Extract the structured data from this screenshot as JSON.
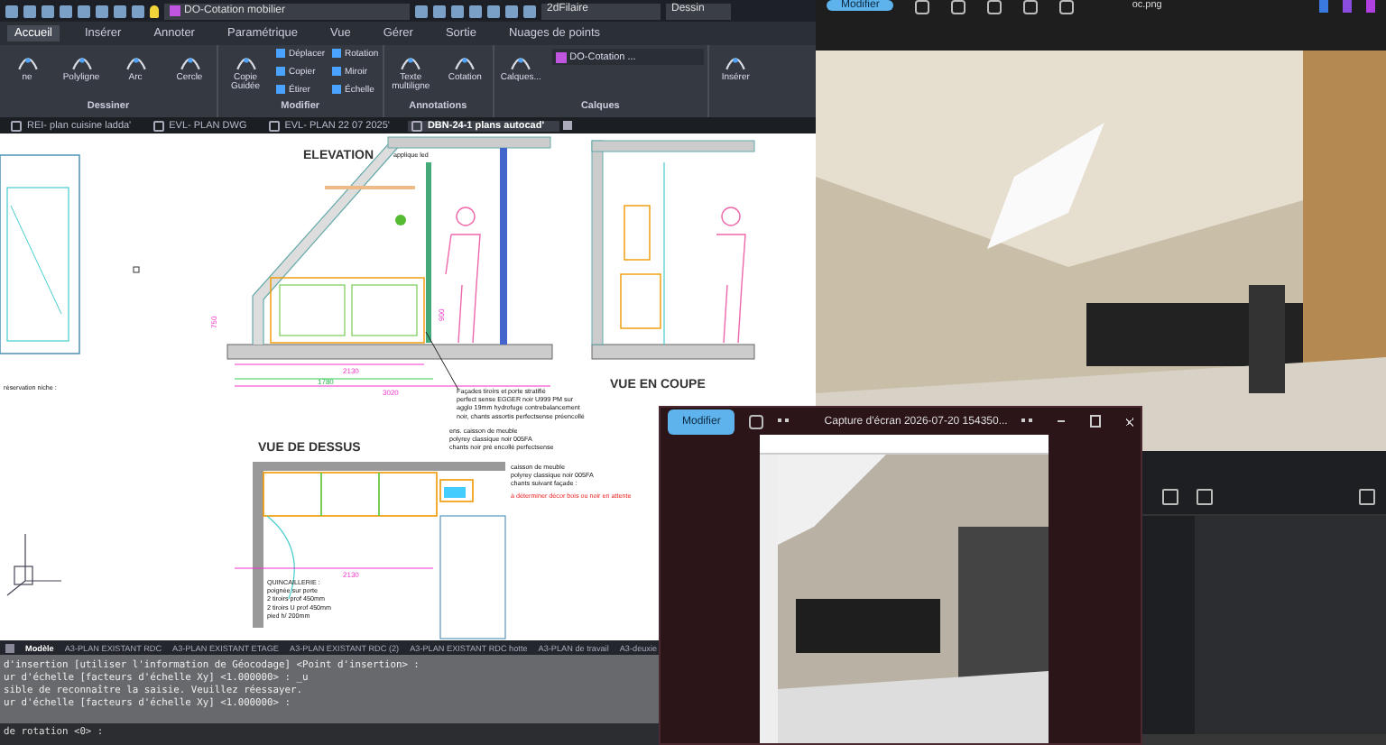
{
  "cad": {
    "quick_access": {
      "layer": "DO-Cotation mobilier",
      "visual_style": "2dFilaire",
      "workspace": "Dessin"
    },
    "ribbon_tabs": [
      {
        "label": "Accueil",
        "selected": true
      },
      {
        "label": "Insérer",
        "selected": false
      },
      {
        "label": "Annoter",
        "selected": false
      },
      {
        "label": "Paramétrique",
        "selected": false
      },
      {
        "label": "Vue",
        "selected": false
      },
      {
        "label": "Gérer",
        "selected": false
      },
      {
        "label": "Sortie",
        "selected": false
      },
      {
        "label": "Nuages de points",
        "selected": false
      }
    ],
    "panels": [
      {
        "title": "Dessiner",
        "tools": [
          {
            "label": "ne",
            "kind": "large"
          },
          {
            "label": "Polyligne",
            "kind": "large"
          },
          {
            "label": "Arc",
            "kind": "large"
          },
          {
            "label": "Cercle",
            "kind": "large"
          }
        ]
      },
      {
        "title": "Modifier",
        "tools": [
          {
            "label": "Copie Guidée",
            "kind": "large"
          },
          {
            "label": "Déplacer",
            "kind": "small"
          },
          {
            "label": "Copier",
            "kind": "small"
          },
          {
            "label": "Étirer",
            "kind": "small"
          },
          {
            "label": "Rotation",
            "kind": "small"
          },
          {
            "label": "Miroir",
            "kind": "small"
          },
          {
            "label": "Échelle",
            "kind": "small"
          }
        ]
      },
      {
        "title": "Annotations",
        "tools": [
          {
            "label": "Texte multiligne",
            "kind": "large"
          },
          {
            "label": "Cotation",
            "kind": "large"
          }
        ]
      },
      {
        "title": "Calques",
        "tools": [
          {
            "label": "Calques...",
            "kind": "large"
          },
          {
            "label": "DO-Cotation ...",
            "kind": "dropdown"
          }
        ]
      },
      {
        "tools": [
          {
            "label": "Insérer",
            "kind": "large"
          }
        ]
      }
    ],
    "doc_tabs": [
      {
        "label": "REI- plan cuisine ladda'",
        "selected": false
      },
      {
        "label": "EVL- PLAN DWG",
        "selected": false
      },
      {
        "label": "EVL- PLAN 22 07 2025'",
        "selected": false
      },
      {
        "label": "DBN-24-1 plans autocad'",
        "selected": true
      }
    ],
    "drawing": {
      "labels": [
        {
          "kind": "title",
          "lines": [
            "ELEVATION"
          ]
        },
        {
          "kind": "title",
          "lines": [
            "VUE EN COUPE"
          ]
        },
        {
          "kind": "title",
          "lines": [
            "VUE DE DESSUS"
          ]
        },
        {
          "kind": "note",
          "lines": [
            "réservation niche :"
          ]
        },
        {
          "kind": "dimension",
          "lines": [
            "2130"
          ]
        },
        {
          "kind": "dimension_alt",
          "lines": [
            "1780"
          ]
        },
        {
          "kind": "dimension",
          "lines": [
            "3020"
          ]
        },
        {
          "kind": "dimension",
          "lines": [
            "2130"
          ]
        },
        {
          "kind": "dimension",
          "lines": [
            "900"
          ]
        },
        {
          "kind": "dimension",
          "lines": [
            "750"
          ]
        },
        {
          "kind": "note",
          "lines": [
            "Façades tiroirs et porte stratifié",
            "perfect sense EGGER noir U999 PM sur",
            "agglo 19mm hydrofuge contrebalancement",
            "noir, chants assortis perfectsense préencollé"
          ]
        },
        {
          "kind": "note",
          "lines": [
            "ens. caisson de meuble",
            "polyrey classique noir 005FA",
            "chants noir pré encollé perfectsense"
          ]
        },
        {
          "kind": "note",
          "lines": [
            "caisson de meuble",
            "polyrey classique noir 005FA",
            "chants suivant façade :"
          ]
        },
        {
          "kind": "warning",
          "lines": [
            "à déterminer décor bois ou noir en attente"
          ]
        },
        {
          "kind": "note",
          "lines": [
            "QUINCAILLERIE :",
            "poignée sur porte",
            "2 tiroirs prof 450mm",
            "2 tiroirs U prof 450mm",
            "pied h/ 200mm"
          ]
        },
        {
          "kind": "note",
          "lines": [
            "applique led"
          ]
        }
      ]
    },
    "layout_tabs": [
      {
        "label": "Modèle",
        "selected": true
      },
      {
        "label": "A3-PLAN EXISTANT RDC",
        "selected": false
      },
      {
        "label": "A3-PLAN EXISTANT ETAGE",
        "selected": false
      },
      {
        "label": "A3-PLAN EXISTANT RDC (2)",
        "selected": false
      },
      {
        "label": "A3-PLAN EXISTANT RDC hotte",
        "selected": false
      },
      {
        "label": "A3-PLAN de travail",
        "selected": false
      },
      {
        "label": "A3-deuxie",
        "selected": false
      }
    ],
    "command_history": [
      "d'insertion [utiliser l'information de Géocodage] <Point d'insertion> :",
      "ur d'échelle [facteurs d'échelle Xy] <1.000000> : _u",
      "sible de reconnaître la saisie. Veuillez réessayer.",
      "ur d'échelle [facteurs d'échelle Xy] <1.000000> :"
    ],
    "command_prompt": "de rotation <0> :"
  },
  "photo_viewer": {
    "edit_button": "Modifier",
    "filename": "oc.png"
  },
  "popup_viewer": {
    "edit_button": "Modifier",
    "title": "Capture d'écran 2026-07-20 154350..."
  }
}
